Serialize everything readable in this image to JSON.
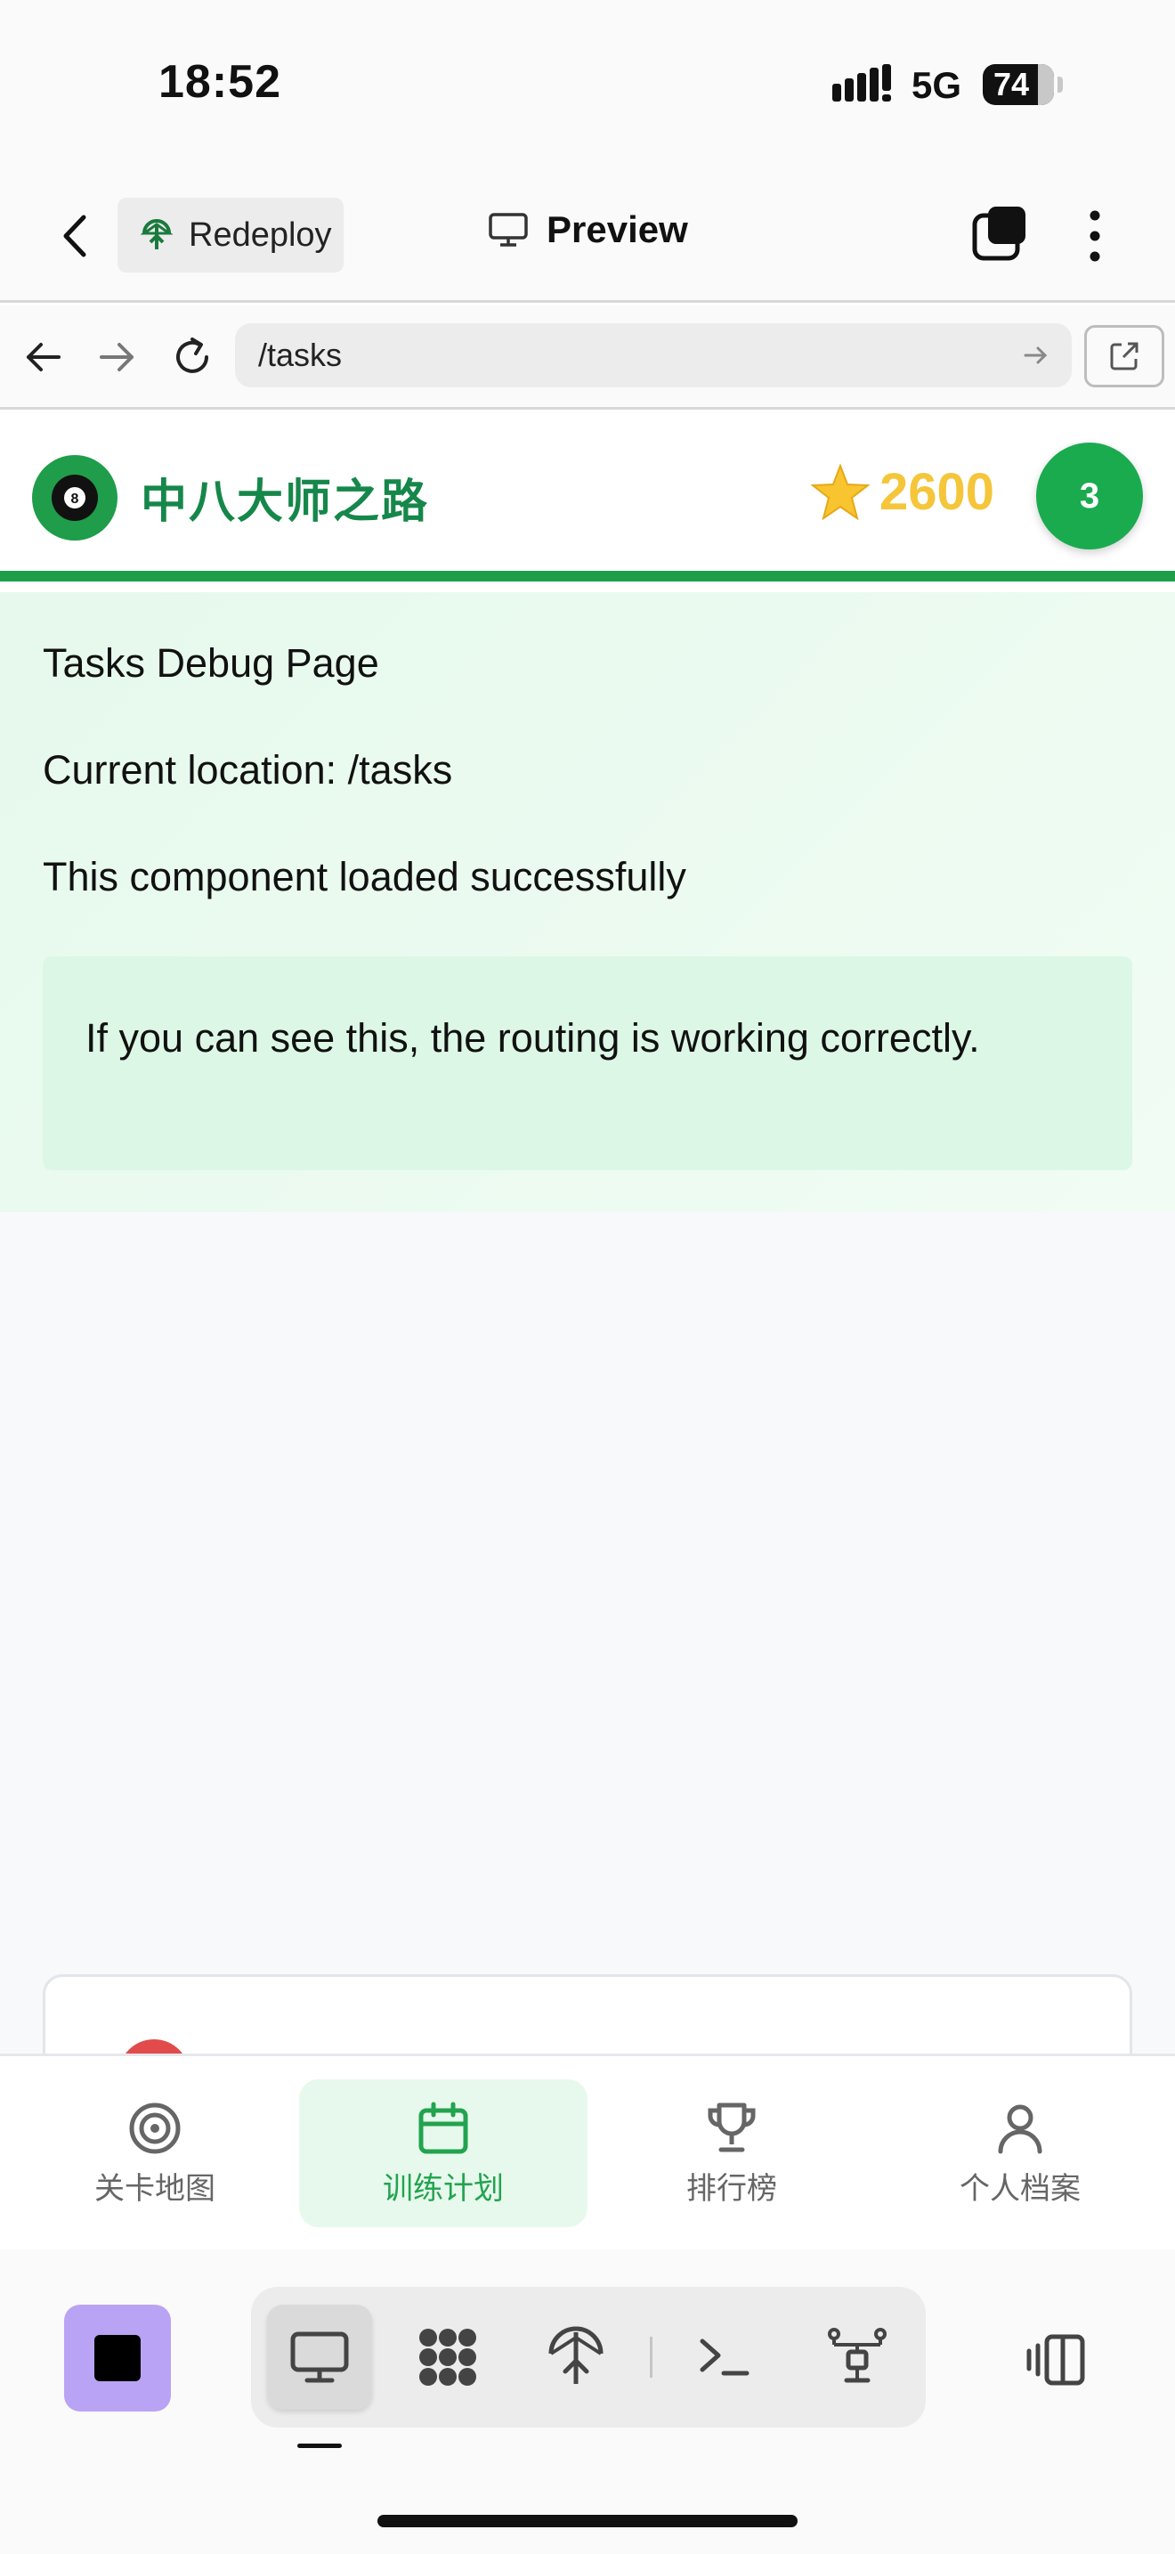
{
  "status_bar": {
    "time": "18:52",
    "network": "5G",
    "battery": "74"
  },
  "topbar": {
    "redeploy_label": "Redeploy",
    "preview_label": "Preview"
  },
  "urlbar": {
    "url": "/tasks"
  },
  "app": {
    "title": "中八大师之路",
    "points": "2600",
    "level": "3"
  },
  "debug": {
    "heading": "Tasks Debug Page",
    "location": "Current location: /tasks",
    "loaded": "This component loaded successfully",
    "note": "If you can see this, the routing is working correctly."
  },
  "bottom_nav": {
    "items": [
      {
        "label": "关卡地图",
        "icon": "target-icon",
        "active": false
      },
      {
        "label": "训练计划",
        "icon": "calendar-icon",
        "active": true
      },
      {
        "label": "排行榜",
        "icon": "trophy-icon",
        "active": false
      },
      {
        "label": "个人档案",
        "icon": "user-icon",
        "active": false
      }
    ]
  },
  "dock": {
    "tools": [
      "preview-icon",
      "apps-icon",
      "deploy-icon",
      "terminal-icon",
      "network-icon"
    ],
    "active_tool": "preview-icon"
  },
  "colors": {
    "brand_green": "#1e9e48",
    "points_gold": "#f5c53a",
    "stop_purple": "#b9a3f5"
  }
}
